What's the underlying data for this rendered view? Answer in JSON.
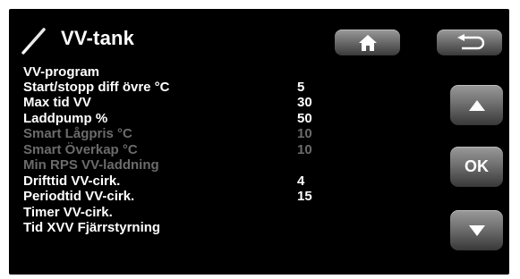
{
  "header": {
    "title": "VV-tank",
    "title_icon": "thermometer-probe-icon",
    "home_icon": "home-icon",
    "back_icon": "back-arrow-icon"
  },
  "menu": {
    "rows": [
      {
        "label": "VV-program",
        "value": "",
        "enabled": true
      },
      {
        "label": "Start/stopp diff övre °C",
        "value": "5",
        "enabled": true
      },
      {
        "label": "Max tid VV",
        "value": "30",
        "enabled": true
      },
      {
        "label": "Laddpump %",
        "value": "50",
        "enabled": true
      },
      {
        "label": "Smart Lågpris °C",
        "value": "10",
        "enabled": false
      },
      {
        "label": "Smart Överkap °C",
        "value": "10",
        "enabled": false
      },
      {
        "label": "Min RPS VV-laddning",
        "value": "",
        "enabled": false
      },
      {
        "label": "Drifttid VV-cirk.",
        "value": "4",
        "enabled": true
      },
      {
        "label": "Periodtid VV-cirk.",
        "value": "15",
        "enabled": true
      },
      {
        "label": "Timer VV-cirk.",
        "value": "",
        "enabled": true
      },
      {
        "label": "Tid XVV Fjärrstyrning",
        "value": "",
        "enabled": true
      }
    ]
  },
  "side": {
    "up_icon": "arrow-up-icon",
    "ok_label": "OK",
    "down_icon": "arrow-down-icon"
  },
  "colors": {
    "background": "#000000",
    "text_enabled": "#ffffff",
    "text_disabled": "#6b6b6b"
  }
}
